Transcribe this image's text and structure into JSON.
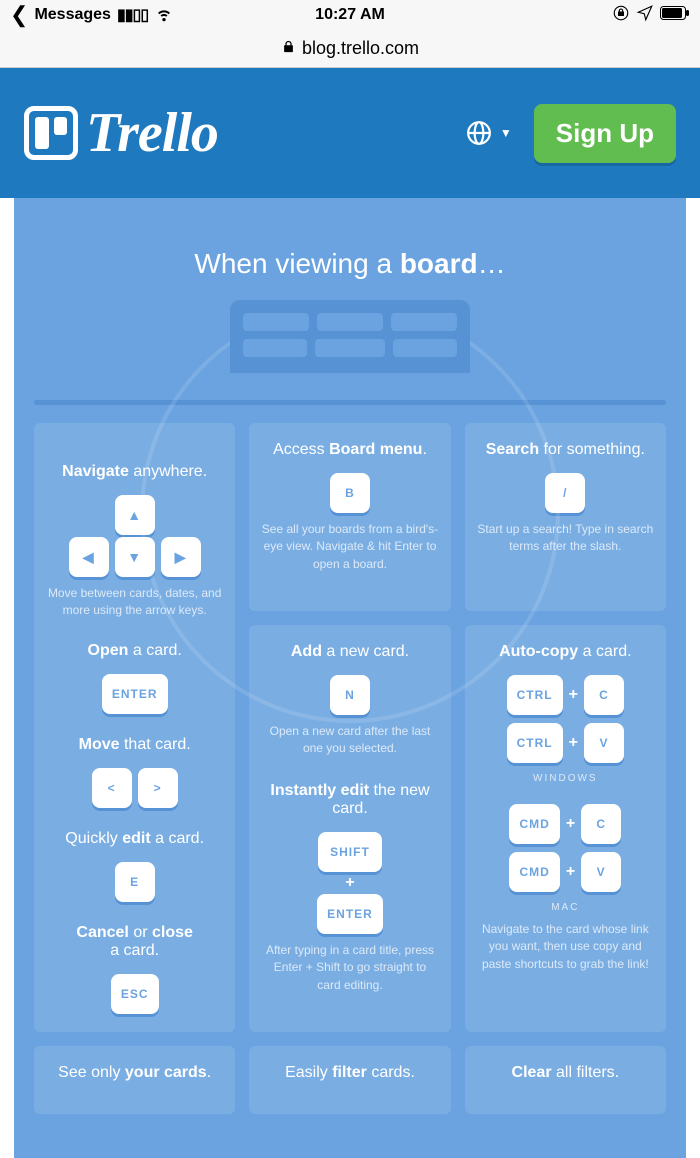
{
  "status": {
    "back_app": "Messages",
    "time": "10:27 AM",
    "lock_icon": "lock-rotation",
    "location_icon": "location",
    "battery_icon": "battery"
  },
  "url_bar": {
    "lock": "🔒",
    "domain": "blog.trello.com"
  },
  "header": {
    "brand": "Trello",
    "signup": "Sign Up"
  },
  "panel": {
    "title_prefix": "When viewing a ",
    "title_strong": "board",
    "title_suffix": "…"
  },
  "col1": {
    "s1": {
      "title_strong": "Navigate",
      "title_rest": " anywhere.",
      "desc": "Move between cards, dates, and more using the arrow keys.",
      "keys": {
        "up": "▲",
        "left": "◀",
        "down": "▼",
        "right": "▶"
      }
    },
    "s2": {
      "title_strong": "Open",
      "title_rest": " a card.",
      "key": "ENTER"
    },
    "s3": {
      "title_strong": "Move",
      "title_rest": " that card.",
      "keys": {
        "lt": "<",
        "gt": ">"
      }
    },
    "s4": {
      "title_pre": "Quickly ",
      "title_strong": "edit",
      "title_rest": " a card.",
      "key": "E"
    },
    "s5": {
      "title_strong1": "Cancel",
      "title_mid": " or ",
      "title_strong2": "close",
      "title_rest": " a card.",
      "key": "ESC"
    },
    "s6": {
      "title_pre": "See only ",
      "title_strong": "your cards",
      "title_rest": "."
    }
  },
  "col2": {
    "c1": {
      "title_pre": "Access ",
      "title_strong": "Board menu",
      "title_rest": ".",
      "key": "B",
      "desc": "See all your boards from a bird's-eye view. Navigate & hit Enter to open a board."
    },
    "c2": {
      "s1": {
        "title_strong": "Add",
        "title_rest": " a new card.",
        "key": "N",
        "desc": "Open a new card after the last one you selected."
      },
      "s2": {
        "title_strong": "Instantly edit",
        "title_rest": " the new card.",
        "key1": "SHIFT",
        "plus": "+",
        "key2": "ENTER",
        "desc": "After typing in a card title, press Enter + Shift to go straight to card editing."
      }
    },
    "c3": {
      "title_pre": "Easily ",
      "title_strong": "filter",
      "title_rest": " cards."
    }
  },
  "col3": {
    "c1": {
      "title_strong": "Search",
      "title_rest": " for something.",
      "key": "/",
      "desc": "Start up a search! Type in search terms after the slash."
    },
    "c2": {
      "title_strong": "Auto-copy",
      "title_rest": " a card.",
      "win": {
        "ctrl": "CTRL",
        "plus": "+",
        "c": "C",
        "v": "V",
        "label": "WINDOWS"
      },
      "mac": {
        "cmd": "CMD",
        "plus": "+",
        "c": "C",
        "v": "V",
        "label": "MAC"
      },
      "desc": "Navigate to the card whose link you want, then use copy and paste shortcuts to grab the link!"
    },
    "c3": {
      "title_strong": "Clear",
      "title_rest": " all filters."
    }
  }
}
